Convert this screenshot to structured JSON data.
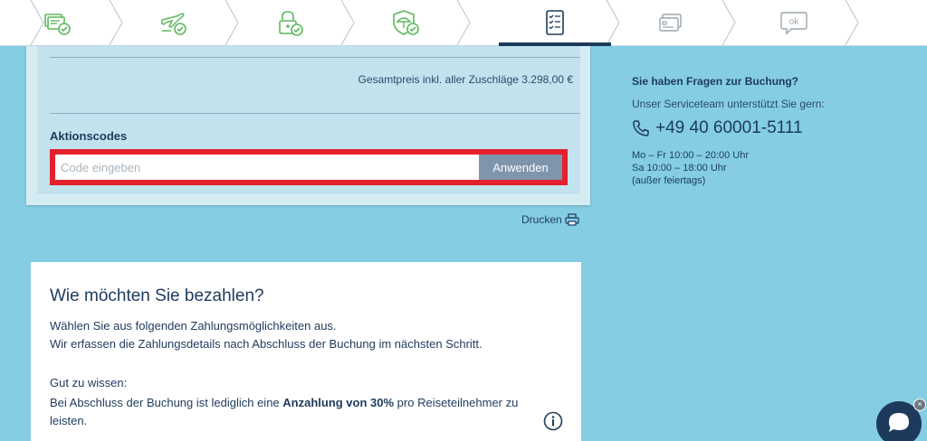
{
  "steps": [
    {
      "icon": "travel-documents-check-icon",
      "active": false
    },
    {
      "icon": "flight-check-icon",
      "active": false
    },
    {
      "icon": "lock-check-icon",
      "active": false
    },
    {
      "icon": "insurance-umbrella-check-icon",
      "active": false
    },
    {
      "icon": "checklist-icon",
      "active": true
    },
    {
      "icon": "payment-card-icon",
      "active": false
    },
    {
      "icon": "ok-bubble-icon",
      "active": false,
      "label": "ok"
    }
  ],
  "summary": {
    "total_label": "Gesamtpreis inkl. aller Zuschläge 3.298,00 €",
    "promo_title": "Aktionscodes",
    "promo_placeholder": "Code eingeben",
    "promo_value": "",
    "promo_button": "Anwenden"
  },
  "print_label": "Drucken",
  "payment": {
    "title": "Wie möchten Sie bezahlen?",
    "line1": "Wählen Sie aus folgenden Zahlungsmöglichkeiten aus.",
    "line2": "Wir erfassen die Zahlungsdetails nach Abschluss der Buchung im nächsten Schritt.",
    "good_to_know": "Gut zu wissen:",
    "deposit_pre": "Bei Abschluss der Buchung ist lediglich eine ",
    "deposit_bold": "Anzahlung von 30%",
    "deposit_post": " pro Reiseteilnehmer zu",
    "deposit_line2": "leisten."
  },
  "sidebar": {
    "question": "Sie haben Fragen zur Buchung?",
    "subtitle": "Unser Serviceteam unterstützt Sie gern:",
    "phone": "+49 40 60001-5111",
    "hours_1": "Mo – Fr 10:00 – 20:00 Uhr",
    "hours_2": "Sa 10:00 – 18:00 Uhr",
    "hours_3": "(außer feiertags)"
  },
  "colors": {
    "background": "#84cde3",
    "navy": "#1d3a5c",
    "green": "#5cb85c",
    "highlight": "#e5202d",
    "button": "#7e95ab"
  }
}
